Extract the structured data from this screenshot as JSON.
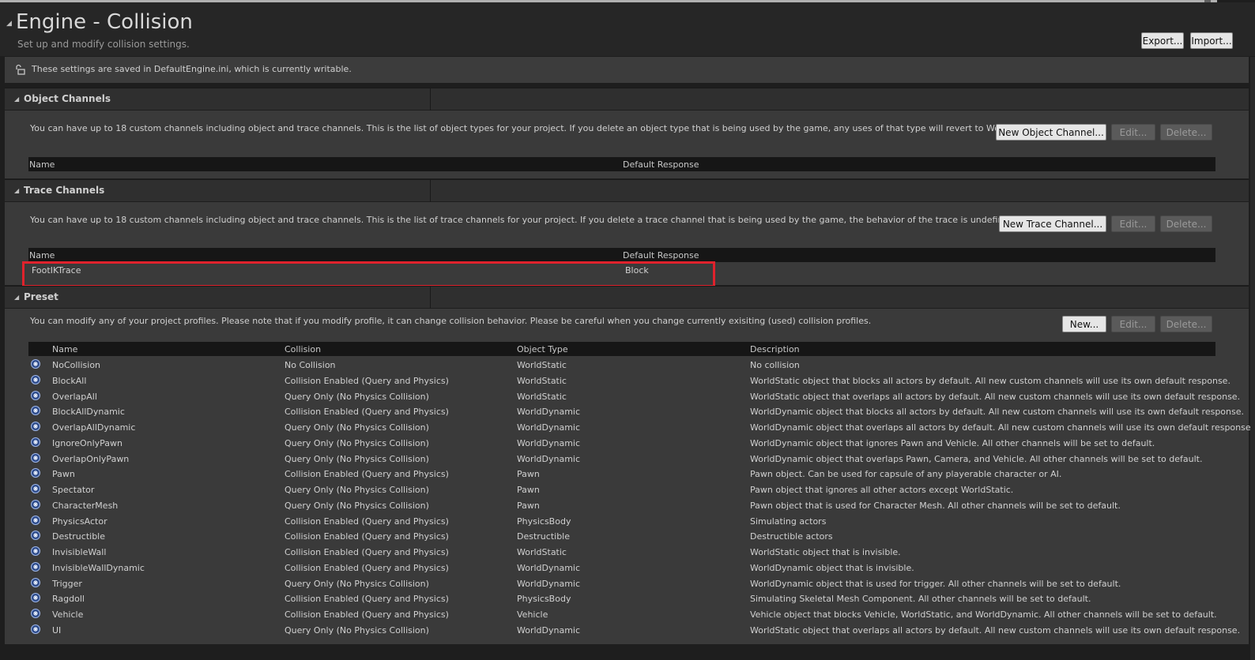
{
  "header": {
    "title": "Engine - Collision",
    "subtitle": "Set up and modify collision settings.",
    "export_label": "Export...",
    "import_label": "Import..."
  },
  "notice": {
    "text": "These settings are saved in DefaultEngine.ini, which is currently writable.",
    "icon": "unlock-icon"
  },
  "object_channels": {
    "title": "Object Channels",
    "description": "You can have up to 18 custom channels including object and trace channels. This is the list of object types for your project. If you delete an object type that is being used by the game, any uses of that type will revert to WorldStatic.",
    "new_label": "New Object Channel...",
    "edit_label": "Edit...",
    "delete_label": "Delete...",
    "col_name": "Name",
    "col_response": "Default Response"
  },
  "trace_channels": {
    "title": "Trace Channels",
    "description": "You can have up to 18 custom channels including object and trace channels. This is the list of trace channels for your project. If you delete a trace channel that is being used by the game, the behavior of the trace is undefined.",
    "new_label": "New Trace Channel...",
    "edit_label": "Edit...",
    "delete_label": "Delete...",
    "col_name": "Name",
    "col_response": "Default Response",
    "rows": [
      {
        "name": "FootIKTrace",
        "response": "Block"
      }
    ]
  },
  "preset": {
    "title": "Preset",
    "description": "You can modify any of your project profiles. Please note that if you modify profile, it can change collision behavior. Please be careful when you change currently exisiting (used) collision profiles.",
    "new_label": "New...",
    "edit_label": "Edit...",
    "delete_label": "Delete...",
    "columns": [
      "Name",
      "Collision",
      "Object Type",
      "Description"
    ],
    "rows": [
      {
        "name": "NoCollision",
        "collision": "No Collision",
        "type": "WorldStatic",
        "desc": "No collision"
      },
      {
        "name": "BlockAll",
        "collision": "Collision Enabled (Query and Physics)",
        "type": "WorldStatic",
        "desc": "WorldStatic object that blocks all actors by default. All new custom channels will use its own default response."
      },
      {
        "name": "OverlapAll",
        "collision": "Query Only (No Physics Collision)",
        "type": "WorldStatic",
        "desc": "WorldStatic object that overlaps all actors by default. All new custom channels will use its own default response."
      },
      {
        "name": "BlockAllDynamic",
        "collision": "Collision Enabled (Query and Physics)",
        "type": "WorldDynamic",
        "desc": "WorldDynamic object that blocks all actors by default. All new custom channels will use its own default response."
      },
      {
        "name": "OverlapAllDynamic",
        "collision": "Query Only (No Physics Collision)",
        "type": "WorldDynamic",
        "desc": "WorldDynamic object that overlaps all actors by default. All new custom channels will use its own default response."
      },
      {
        "name": "IgnoreOnlyPawn",
        "collision": "Query Only (No Physics Collision)",
        "type": "WorldDynamic",
        "desc": "WorldDynamic object that ignores Pawn and Vehicle. All other channels will be set to default."
      },
      {
        "name": "OverlapOnlyPawn",
        "collision": "Query Only (No Physics Collision)",
        "type": "WorldDynamic",
        "desc": "WorldDynamic object that overlaps Pawn, Camera, and Vehicle. All other channels will be set to default."
      },
      {
        "name": "Pawn",
        "collision": "Collision Enabled (Query and Physics)",
        "type": "Pawn",
        "desc": "Pawn object. Can be used for capsule of any playerable character or AI."
      },
      {
        "name": "Spectator",
        "collision": "Query Only (No Physics Collision)",
        "type": "Pawn",
        "desc": "Pawn object that ignores all other actors except WorldStatic."
      },
      {
        "name": "CharacterMesh",
        "collision": "Query Only (No Physics Collision)",
        "type": "Pawn",
        "desc": "Pawn object that is used for Character Mesh. All other channels will be set to default."
      },
      {
        "name": "PhysicsActor",
        "collision": "Collision Enabled (Query and Physics)",
        "type": "PhysicsBody",
        "desc": "Simulating actors"
      },
      {
        "name": "Destructible",
        "collision": "Collision Enabled (Query and Physics)",
        "type": "Destructible",
        "desc": "Destructible actors"
      },
      {
        "name": "InvisibleWall",
        "collision": "Collision Enabled (Query and Physics)",
        "type": "WorldStatic",
        "desc": "WorldStatic object that is invisible."
      },
      {
        "name": "InvisibleWallDynamic",
        "collision": "Collision Enabled (Query and Physics)",
        "type": "WorldDynamic",
        "desc": "WorldDynamic object that is invisible."
      },
      {
        "name": "Trigger",
        "collision": "Query Only (No Physics Collision)",
        "type": "WorldDynamic",
        "desc": "WorldDynamic object that is used for trigger. All other channels will be set to default."
      },
      {
        "name": "Ragdoll",
        "collision": "Collision Enabled (Query and Physics)",
        "type": "PhysicsBody",
        "desc": "Simulating Skeletal Mesh Component. All other channels will be set to default."
      },
      {
        "name": "Vehicle",
        "collision": "Collision Enabled (Query and Physics)",
        "type": "Vehicle",
        "desc": "Vehicle object that blocks Vehicle, WorldStatic, and WorldDynamic. All other channels will be set to default."
      },
      {
        "name": "UI",
        "collision": "Query Only (No Physics Collision)",
        "type": "WorldDynamic",
        "desc": "WorldStatic object that overlaps all actors by default. All new custom channels will use its own default response."
      }
    ]
  }
}
